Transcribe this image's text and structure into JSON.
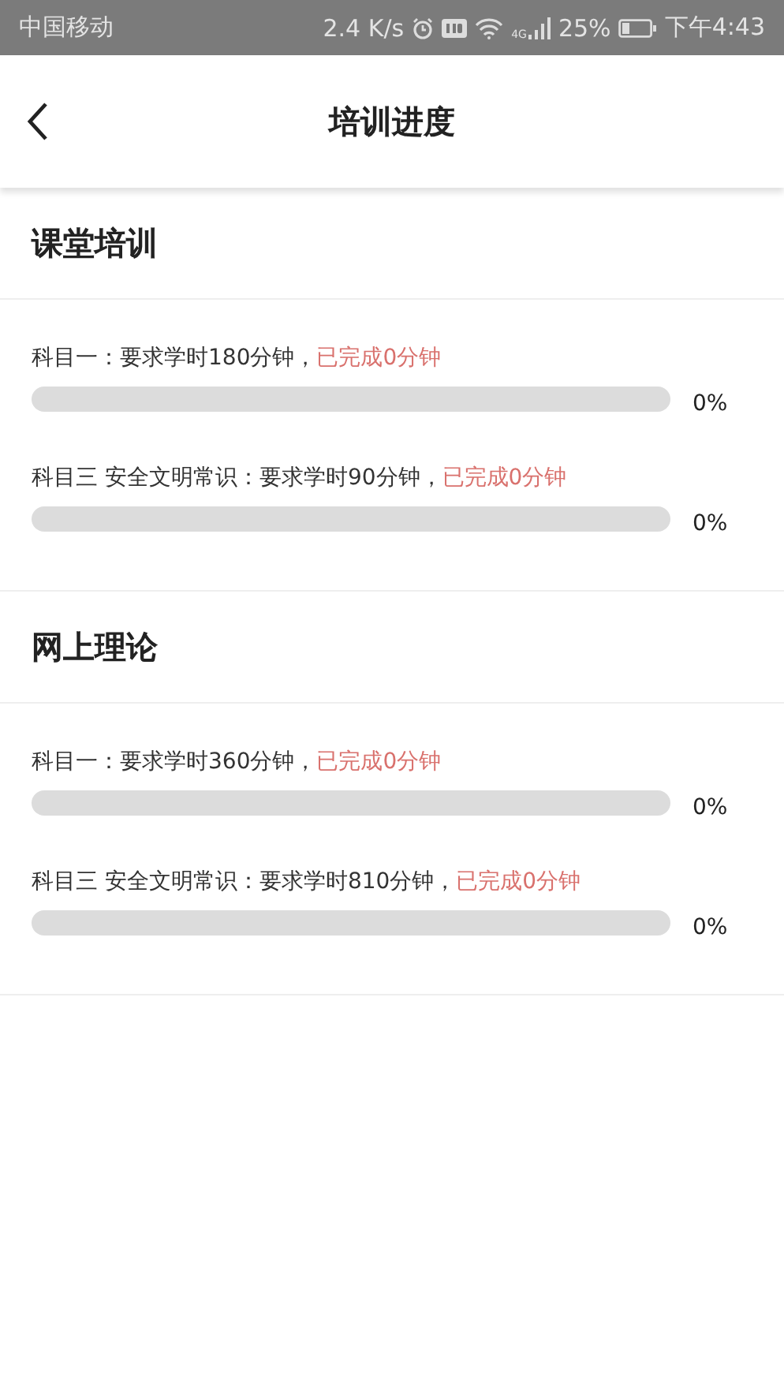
{
  "status_bar": {
    "carrier": "中国移动",
    "speed": "2.4 K/s",
    "network": "4G",
    "battery": "25%",
    "time": "下午4:43"
  },
  "header": {
    "title": "培训进度"
  },
  "sections": [
    {
      "title": "课堂培训",
      "items": [
        {
          "requirement": "科目一：要求学时180分钟，",
          "completed": "已完成0分钟",
          "level": 0,
          "percent": "0%"
        },
        {
          "requirement": "科目三 安全文明常识：要求学时90分钟，",
          "completed": "已完成0分钟",
          "level": 0,
          "percent": "0%"
        }
      ]
    },
    {
      "title": "网上理论",
      "items": [
        {
          "requirement": "科目一：要求学时360分钟，",
          "completed": "已完成0分钟",
          "level": 0,
          "percent": "0%"
        },
        {
          "requirement": "科目三 安全文明常识：要求学时810分钟，",
          "completed": "已完成0分钟",
          "level": 0,
          "percent": "0%"
        }
      ]
    }
  ]
}
